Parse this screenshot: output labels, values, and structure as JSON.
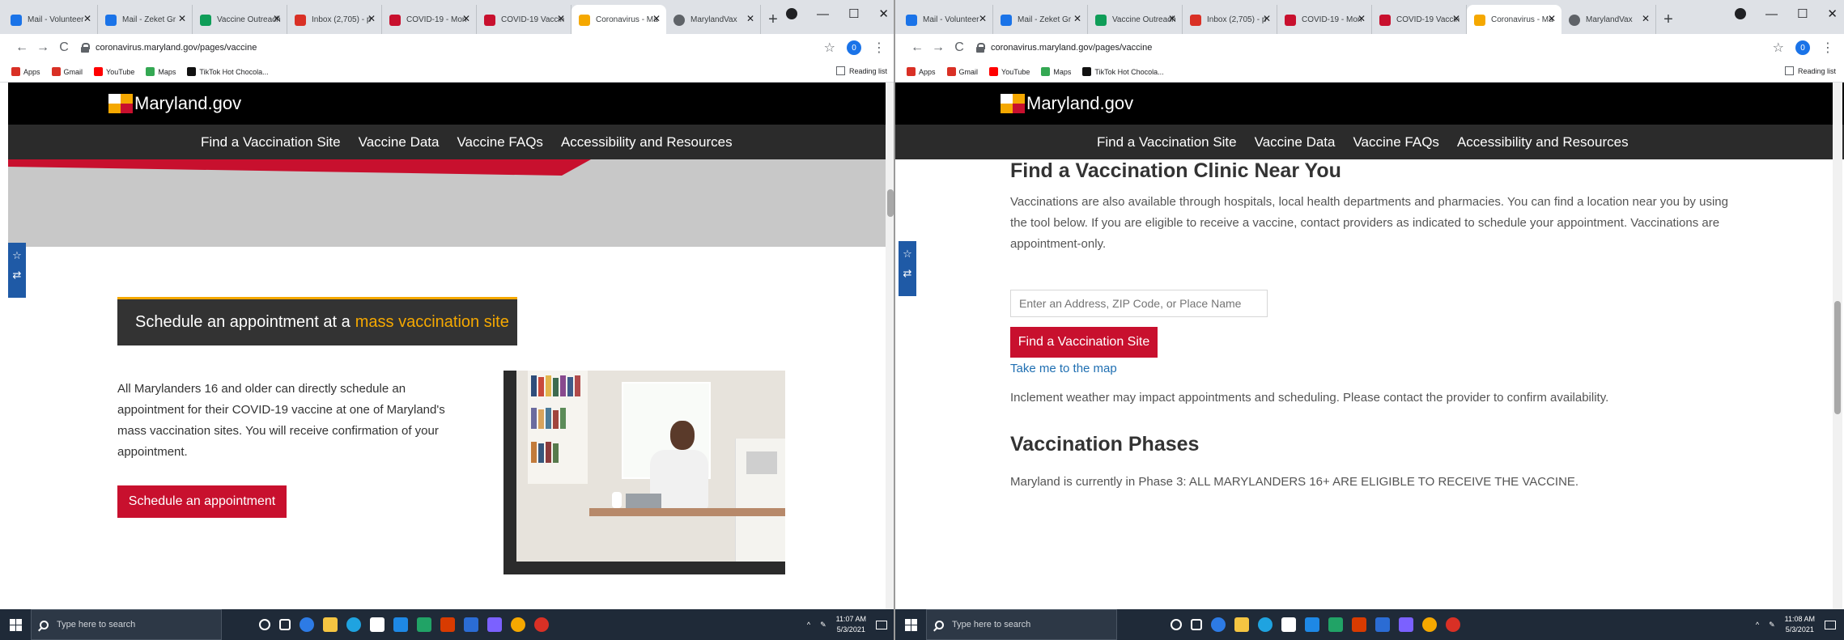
{
  "screens": [
    {
      "tabs": [
        {
          "label": "Mail - Volunteer",
          "color": "#1a73e8"
        },
        {
          "label": "Mail - Zeket Gr",
          "color": "#1a73e8"
        },
        {
          "label": "Vaccine Outreach",
          "color": "#0f9d58"
        },
        {
          "label": "Inbox (2,705) - p",
          "color": "#d93025"
        },
        {
          "label": "COVID-19 - Mon",
          "color": "#c8102e"
        },
        {
          "label": "COVID-19 Vaccin",
          "color": "#c8102e"
        },
        {
          "label": "Coronavirus - Ma",
          "color": "#f5a800",
          "active": true
        },
        {
          "label": "MarylandVax",
          "color": "#5f6368"
        }
      ],
      "url": "coronavirus.maryland.gov/pages/vaccine",
      "clock_time": "11:07 AM",
      "clock_date": "5/3/2021"
    },
    {
      "tabs": [
        {
          "label": "Mail - Volunteer",
          "color": "#1a73e8"
        },
        {
          "label": "Mail - Zeket Gr",
          "color": "#1a73e8"
        },
        {
          "label": "Vaccine Outreach",
          "color": "#0f9d58"
        },
        {
          "label": "Inbox (2,705) - p",
          "color": "#d93025"
        },
        {
          "label": "COVID-19 - Mon",
          "color": "#c8102e"
        },
        {
          "label": "COVID-19 Vaccin",
          "color": "#c8102e"
        },
        {
          "label": "Coronavirus - Ma",
          "color": "#f5a800",
          "active": true
        },
        {
          "label": "MarylandVax",
          "color": "#5f6368"
        }
      ],
      "url": "coronavirus.maryland.gov/pages/vaccine",
      "clock_time": "11:08 AM",
      "clock_date": "5/3/2021"
    }
  ],
  "toolbar": {
    "back": "←",
    "forward": "→",
    "reload": "C",
    "star": "☆",
    "profile_badge": "0",
    "menu": "⋮"
  },
  "bookmarks": [
    {
      "label": "Apps",
      "color": "#d93025"
    },
    {
      "label": "Gmail",
      "color": "#d93025"
    },
    {
      "label": "YouTube",
      "color": "#ff0000"
    },
    {
      "label": "Maps",
      "color": "#34a853"
    },
    {
      "label": "TikTok Hot Chocola...",
      "color": "#111111"
    }
  ],
  "reading_list": "Reading list",
  "site": {
    "logo_text": "Maryland.gov",
    "nav": [
      "Find a Vaccination Site",
      "Vaccine Data",
      "Vaccine FAQs",
      "Accessibility and Resources"
    ]
  },
  "left_page": {
    "banner_prefix": "Schedule an appointment at a",
    "banner_highlight": "mass vaccination site",
    "body": "All Marylanders 16 and older can directly schedule an appointment for their COVID-19 vaccine at one of Maryland's mass vaccination sites. You will receive confirmation of your appointment.",
    "button": "Schedule an appointment"
  },
  "right_page": {
    "heading": "Find a Vaccination Clinic Near You",
    "intro": "Vaccinations are also available through hospitals, local health departments and pharmacies. You can find a location near you by using the tool below. If you are eligible to receive a vaccine, contact providers as indicated to schedule your appointment. Vaccinations are appointment-only.",
    "search_placeholder": "Enter an Address, ZIP Code, or Place Name",
    "find_button": "Find a Vaccination Site",
    "map_link": "Take me to the map",
    "weather_note": "Inclement weather may impact appointments and scheduling. Please contact the provider to confirm availability.",
    "phases_heading": "Vaccination Phases",
    "phases_text": "Maryland is currently in Phase 3: ALL MARYLANDERS 16+ ARE ELIGIBLE TO RECEIVE THE VACCINE."
  },
  "taskbar": {
    "search_placeholder": "Type here to search",
    "apps": [
      "#ffffff",
      "#ffffff",
      "#2d7be5",
      "#f5c542",
      "#1fa3e0",
      "#ffffff",
      "#1e88e5",
      "#21a366",
      "#d83b01",
      "#2b6cd4",
      "#7b61ff",
      "#f5a800",
      "#d93025"
    ]
  },
  "colors": {
    "brand_red": "#c8102e",
    "brand_gold": "#f5a800",
    "header_black": "#000000",
    "nav_dark": "#2b2b2b",
    "link_blue": "#1f6fb2"
  }
}
